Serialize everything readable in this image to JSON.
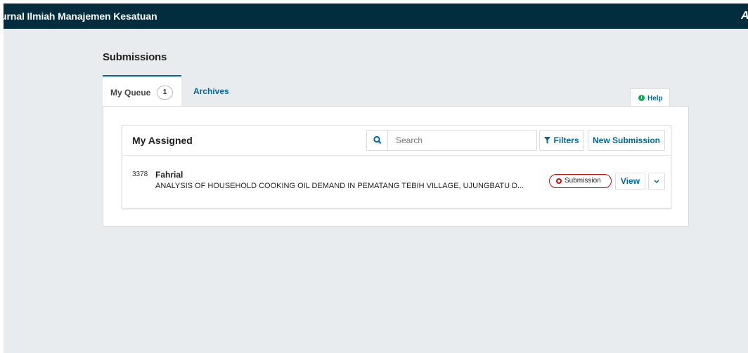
{
  "header": {
    "title": "urnal Ilmiah Manajemen Kesatuan",
    "account_icon": "user-icon"
  },
  "page": {
    "title": "Submissions"
  },
  "tabs": [
    {
      "label": "My Queue",
      "count": "1",
      "active": true
    },
    {
      "label": "Archives",
      "active": false
    }
  ],
  "help": {
    "label": "Help",
    "icon": "info-icon"
  },
  "list": {
    "title": "My Assigned",
    "search": {
      "placeholder": "Search",
      "value": ""
    },
    "filters_label": "Filters",
    "new_submission_label": "New Submission",
    "items": [
      {
        "id": "3378",
        "author": "Fahrial",
        "title": "ANALYSIS OF HOUSEHOLD COOKING OIL DEMAND IN PEMATANG TEBIH VILLAGE, UJUNGBATU D...",
        "stage": "Submission",
        "view_label": "View"
      }
    ]
  },
  "colors": {
    "topbar": "#022d3e",
    "link": "#006798",
    "stage": "#d00a0a",
    "help": "#00b24e",
    "background": "#e9ecee"
  }
}
